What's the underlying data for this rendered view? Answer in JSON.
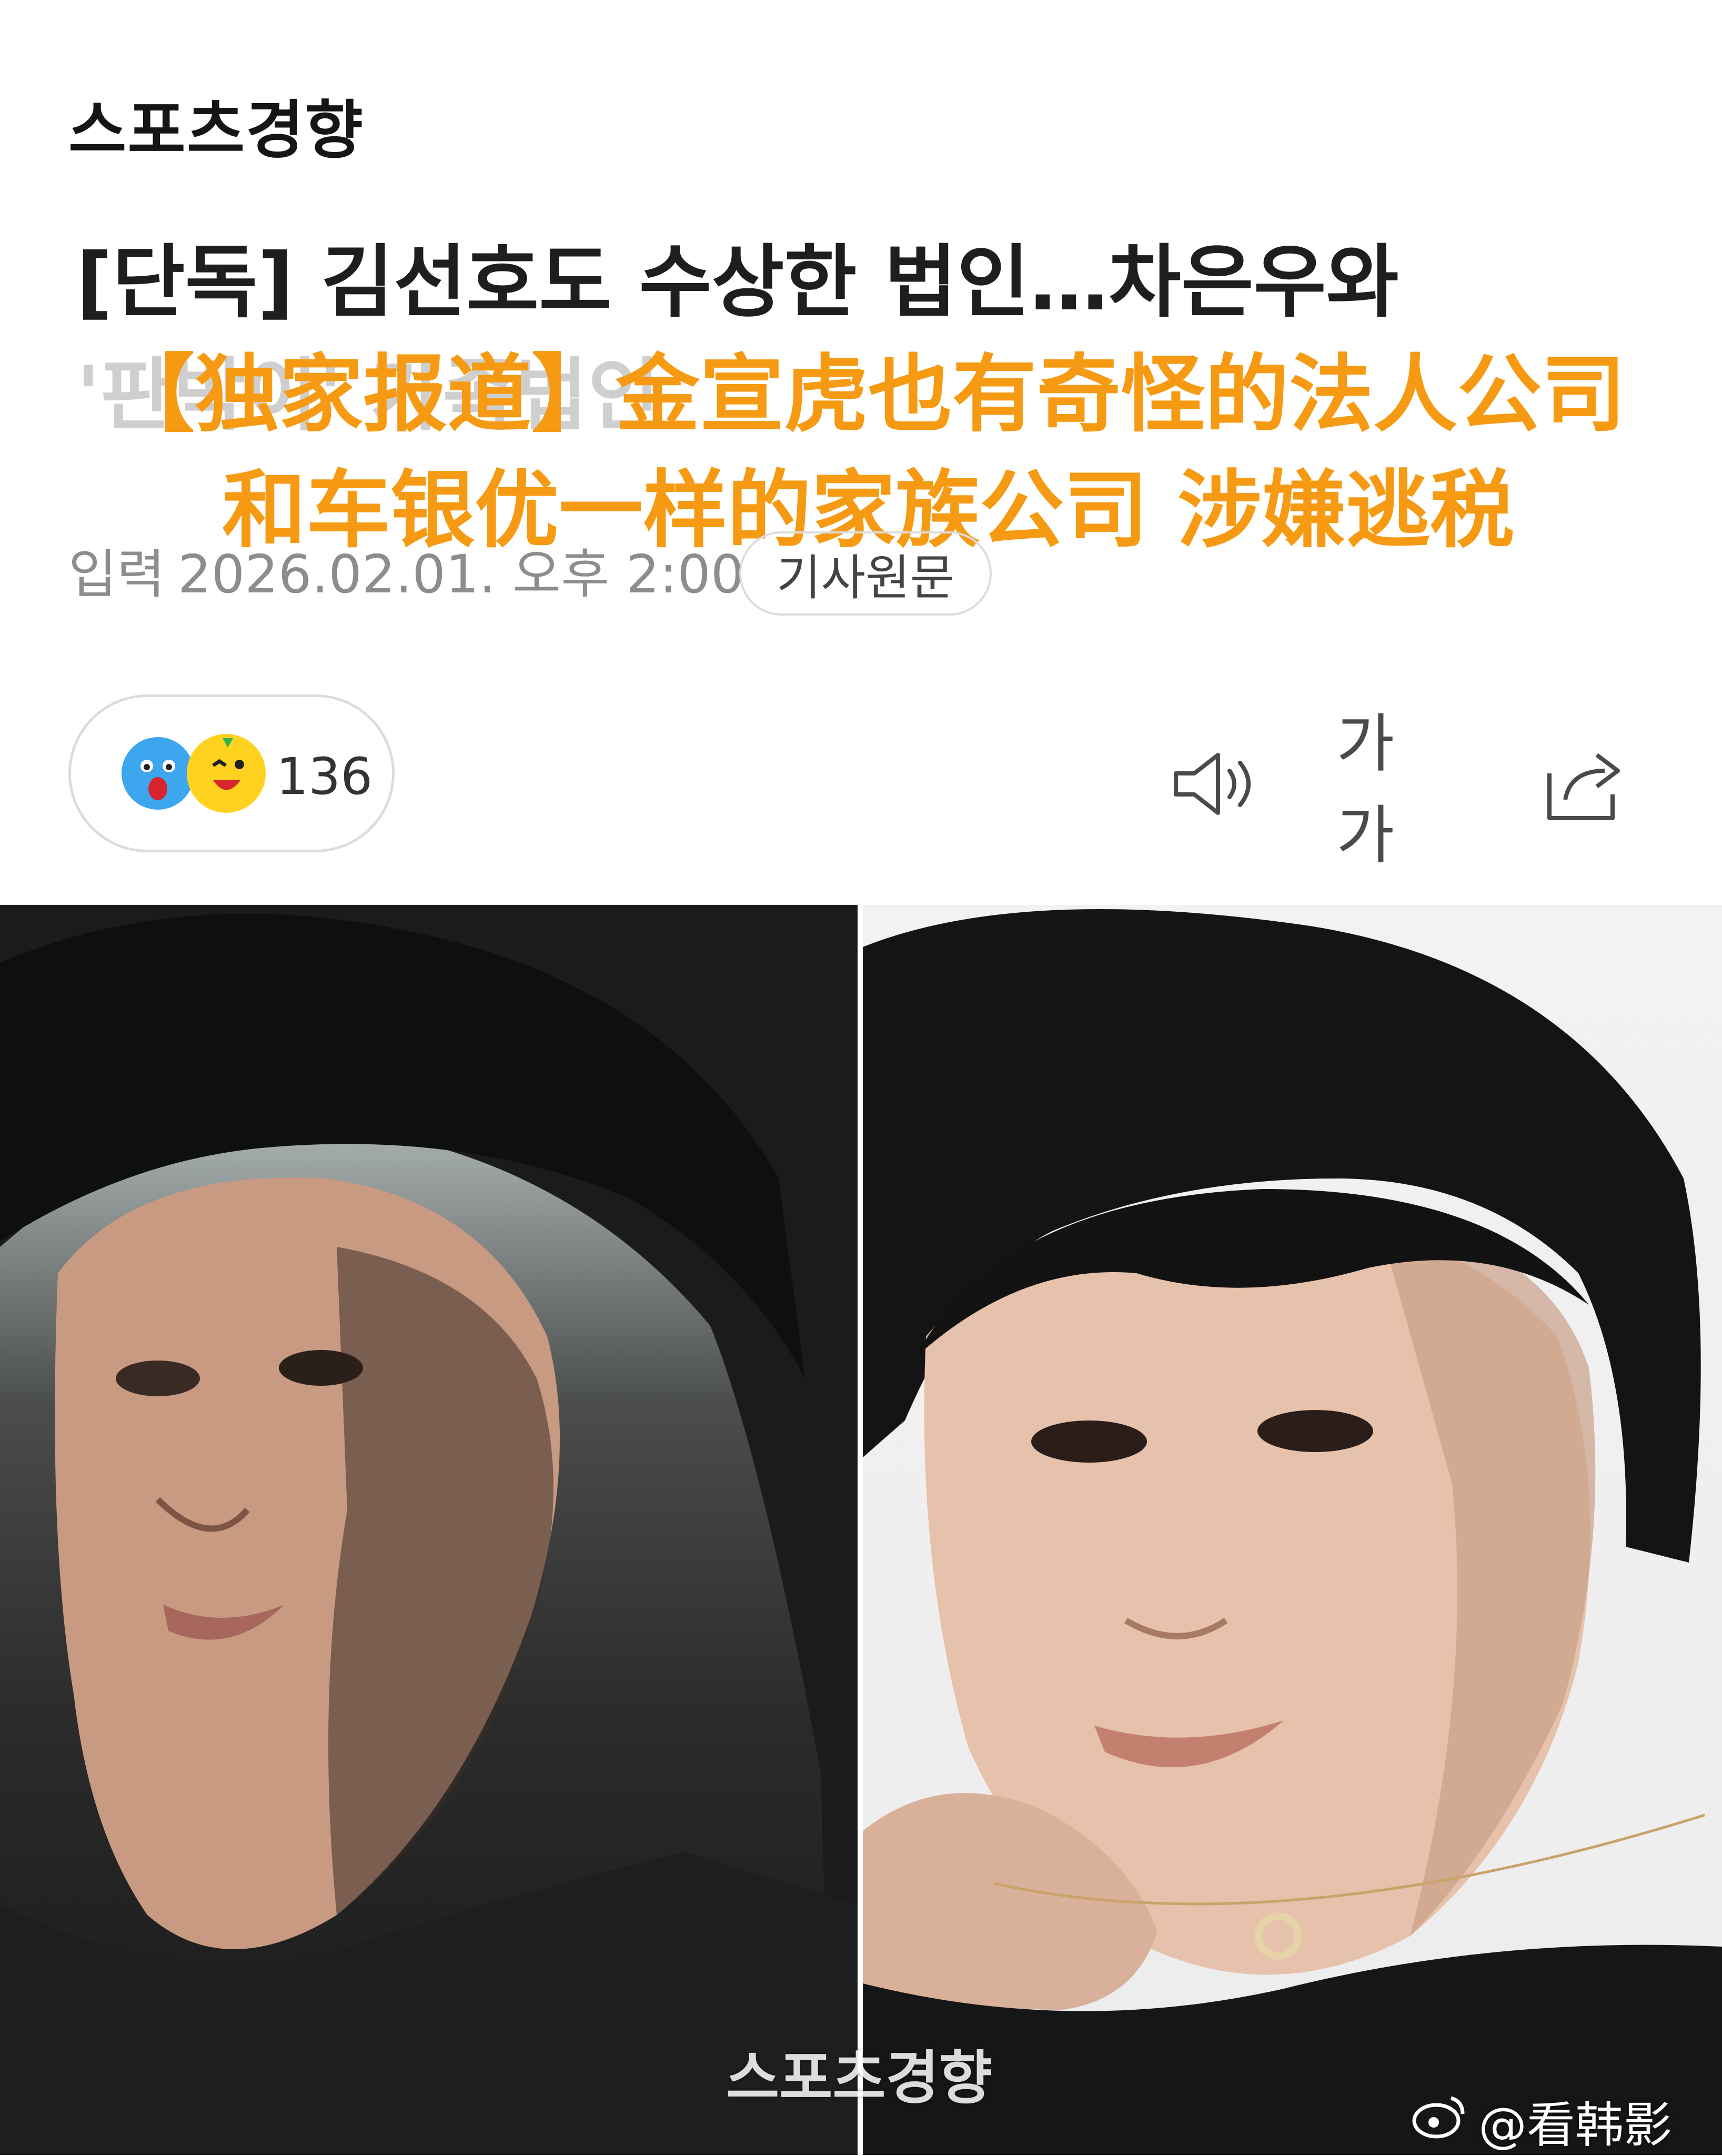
{
  "header": {
    "logo_text": "스포츠경향"
  },
  "article": {
    "headline_line1": "[단독] 김선호도 수상한 법인…차은우와",
    "headline_line2": "'판박이' 가족법인",
    "overlay_line1": "【独家报道】金宣虎也有奇怪的法人公司",
    "overlay_line2": "和车银优一样的家族公司 涉嫌逃税",
    "meta_label": "입력",
    "meta_datetime": "2026.02.01. 오후 2:00",
    "original_button": "기사원문"
  },
  "reactions": {
    "count": "136"
  },
  "toolbar": {
    "speaker_icon": "speaker-icon",
    "font_size_label": "가가",
    "share_icon": "share-icon"
  },
  "photo": {
    "watermark": "스포츠경향",
    "weibo_handle": "@看韩影"
  },
  "colors": {
    "overlay_orange": "#f59a12",
    "meta_gray": "#8d8d8d",
    "pill_border": "#dcdcdc"
  }
}
